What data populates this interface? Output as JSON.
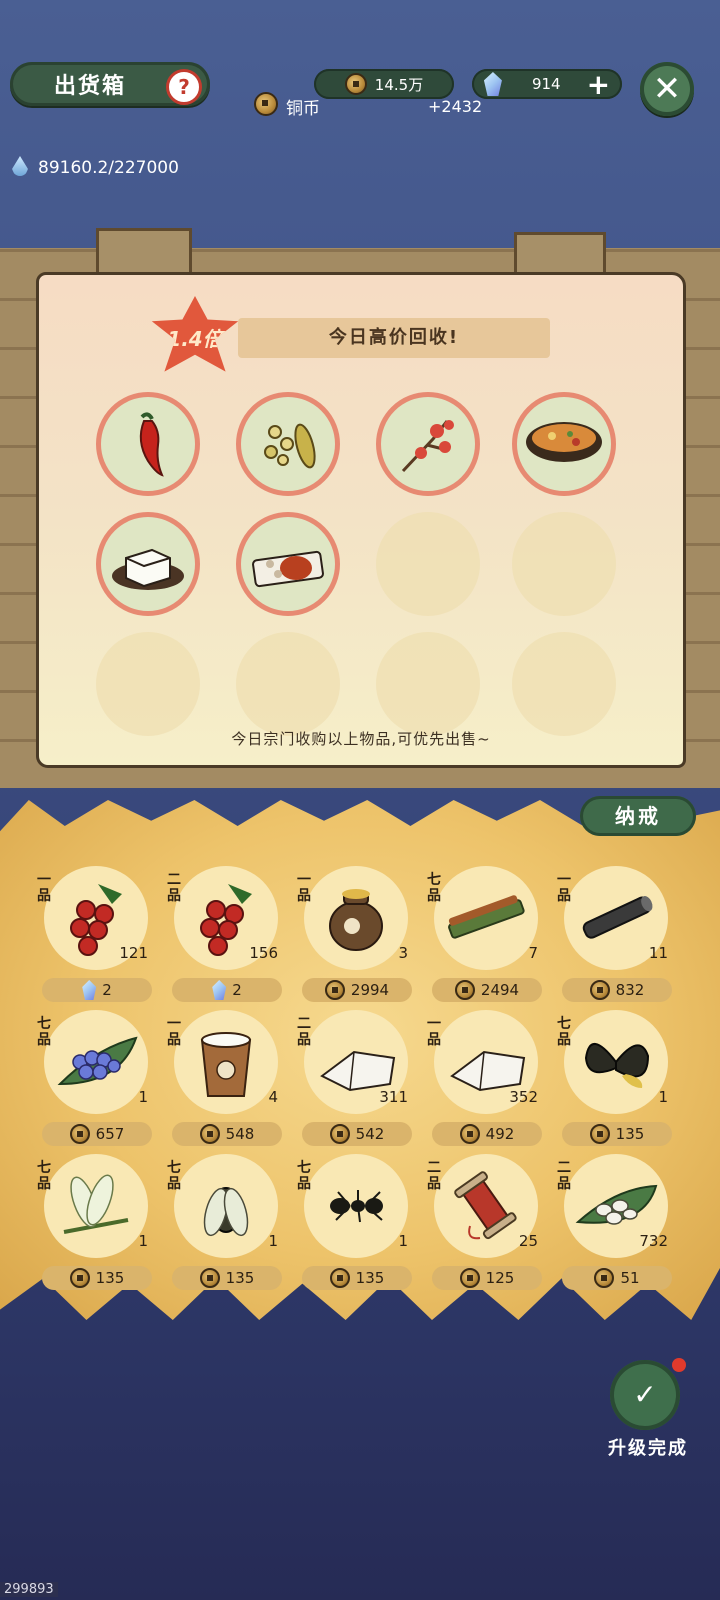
{
  "header": {
    "title": "出货箱",
    "help_icon": "question-icon",
    "copper_amount": "14.5万",
    "copper_label": "铜币",
    "copper_delta": "+2432",
    "gem_amount": "914",
    "plus": "+",
    "close": "✕",
    "water_value": "89160.2/227000"
  },
  "board": {
    "multiplier": "1.4倍",
    "banner": "今日高价回收!",
    "notice": "今日宗门收购以上物品,可优先出售~",
    "items": [
      "chili-pepper",
      "soybean-pods",
      "plum-blossom-branch",
      "stew-bowl",
      "tofu-plate",
      "roast-duck-plate"
    ],
    "empty_slots": 6
  },
  "inventory": {
    "tab_label": "纳戒",
    "rows": [
      [
        {
          "icon": "red-berries",
          "grade": "一品",
          "count": "121",
          "price": "2",
          "currency": "gem"
        },
        {
          "icon": "red-berries",
          "grade": "二品",
          "count": "156",
          "price": "2",
          "currency": "gem"
        },
        {
          "icon": "clay-jar",
          "grade": "一品",
          "count": "3",
          "price": "2994",
          "currency": "coin"
        },
        {
          "icon": "grass-skewer",
          "grade": "七品",
          "count": "7",
          "price": "2494",
          "currency": "coin"
        },
        {
          "icon": "dark-log",
          "grade": "一品",
          "count": "11",
          "price": "832",
          "currency": "coin"
        }
      ],
      [
        {
          "icon": "blue-flowers-on-leaf",
          "grade": "七品",
          "count": "1",
          "price": "657",
          "currency": "coin"
        },
        {
          "icon": "milk-bucket",
          "grade": "一品",
          "count": "4",
          "price": "548",
          "currency": "coin"
        },
        {
          "icon": "white-cloth",
          "grade": "二品",
          "count": "311",
          "price": "542",
          "currency": "coin"
        },
        {
          "icon": "white-cloth",
          "grade": "一品",
          "count": "352",
          "price": "492",
          "currency": "coin"
        },
        {
          "icon": "black-butterfly",
          "grade": "七品",
          "count": "1",
          "price": "135",
          "currency": "coin"
        }
      ],
      [
        {
          "icon": "dragonfly",
          "grade": "七品",
          "count": "1",
          "price": "135",
          "currency": "coin"
        },
        {
          "icon": "cicada",
          "grade": "七品",
          "count": "1",
          "price": "135",
          "currency": "coin"
        },
        {
          "icon": "ant",
          "grade": "七品",
          "count": "1",
          "price": "135",
          "currency": "coin"
        },
        {
          "icon": "thread-spool",
          "grade": "二品",
          "count": "25",
          "price": "125",
          "currency": "coin"
        },
        {
          "icon": "silk-cocoons",
          "grade": "二品",
          "count": "732",
          "price": "51",
          "currency": "coin"
        }
      ]
    ]
  },
  "footer": {
    "upgrade_label": "升级完成",
    "corner_id": "299893"
  },
  "colors": {
    "background_top": "#4a5f93",
    "board_wood": "#a38b63",
    "straw": "#edc36a",
    "green_button": "#3f6f4c",
    "slot_ring": "#e78a72"
  }
}
